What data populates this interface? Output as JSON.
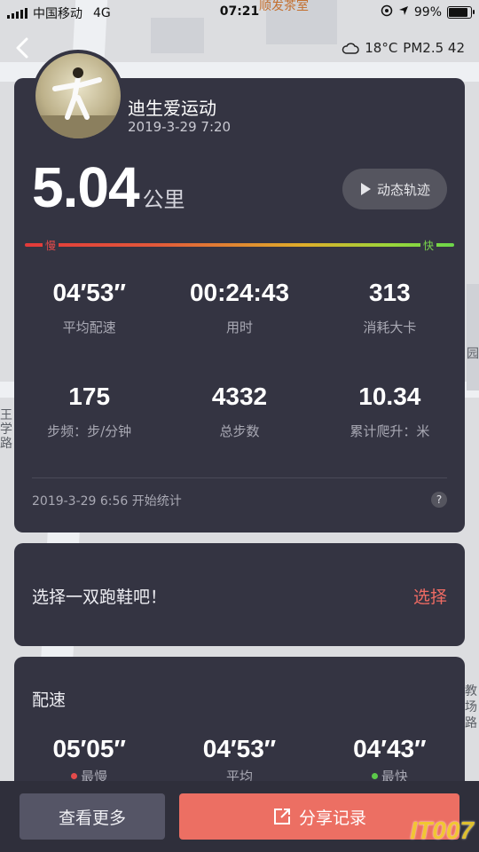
{
  "status_bar": {
    "carrier": "中国移动",
    "network": "4G",
    "time": "07:21",
    "battery": "99%",
    "battery_level": 0.99
  },
  "map": {
    "label_top": "顺发茶室",
    "label_right": "园",
    "label_left": "王学路",
    "label_right2": "教场路"
  },
  "weather": {
    "temp": "18°C",
    "pm": "PM2.5 42"
  },
  "user": {
    "name": "迪生爱运动",
    "date": "2019-3-29 7:20"
  },
  "summary": {
    "distance": "5.04",
    "unit": "公里",
    "track_button": "动态轨迹"
  },
  "speed_bar": {
    "slow": "慢",
    "fast": "快"
  },
  "stats": [
    {
      "value": "04′53″",
      "label": "平均配速"
    },
    {
      "value": "00:24:43",
      "label": "用时"
    },
    {
      "value": "313",
      "label": "消耗大卡"
    },
    {
      "value": "175",
      "label": "步频：步/分钟"
    },
    {
      "value": "4332",
      "label": "总步数"
    },
    {
      "value": "10.34",
      "label": "累计爬升：米"
    }
  ],
  "start_stat": "2019-3-29 6:56 开始统计",
  "help": "?",
  "shoe": {
    "text": "选择一双跑鞋吧！",
    "button": "选择"
  },
  "pace": {
    "title": "配速",
    "items": [
      {
        "value": "05′05″",
        "label": "最慢",
        "dot_color": "#e44b4b"
      },
      {
        "value": "04′53″",
        "label": "平均",
        "dot_color": ""
      },
      {
        "value": "04′43″",
        "label": "最快",
        "dot_color": "#5cc94a"
      }
    ]
  },
  "bottom": {
    "more": "查看更多",
    "share": "分享记录"
  },
  "watermark": "IT007",
  "colors": {
    "card": "#343442",
    "accent": "#ec6f63"
  }
}
